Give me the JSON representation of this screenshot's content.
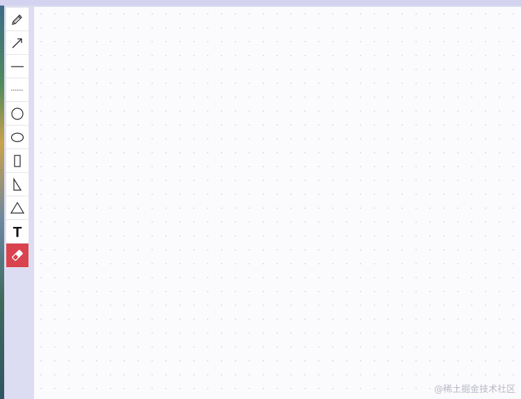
{
  "toolbar": {
    "tools": [
      {
        "name": "pencil",
        "icon": "pencil-icon"
      },
      {
        "name": "arrow",
        "icon": "arrow-icon"
      },
      {
        "name": "line",
        "icon": "line-icon"
      },
      {
        "name": "dashed-line",
        "icon": "dashed-line-icon"
      },
      {
        "name": "circle",
        "icon": "circle-icon"
      },
      {
        "name": "ellipse",
        "icon": "ellipse-icon"
      },
      {
        "name": "rectangle",
        "icon": "rectangle-icon"
      },
      {
        "name": "right-triangle",
        "icon": "right-triangle-icon"
      },
      {
        "name": "triangle",
        "icon": "triangle-icon"
      },
      {
        "name": "text",
        "icon": "text-icon",
        "label": "T"
      },
      {
        "name": "eraser",
        "icon": "eraser-icon",
        "active": true
      }
    ],
    "active_color": "#d9434e"
  },
  "watermark": "@稀土掘金技术社区"
}
